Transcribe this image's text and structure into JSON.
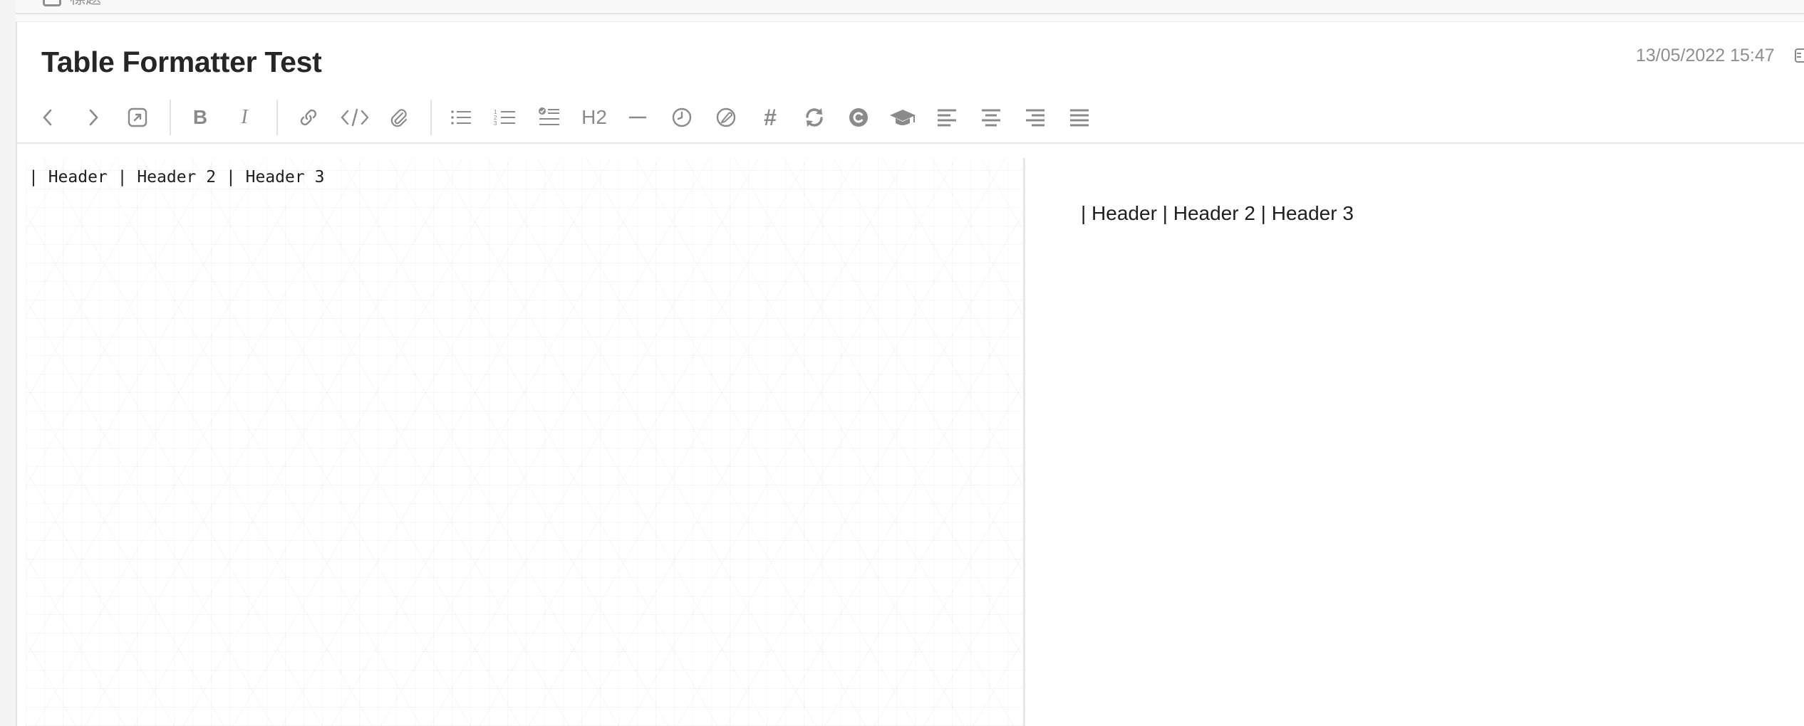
{
  "top_strip": {
    "label": "標題"
  },
  "note": {
    "title": "Table Formatter Test",
    "modified": "13/05/2022 15:47"
  },
  "toolbar": {
    "back": "chevron-left-icon",
    "forward": "chevron-right-icon",
    "external": "external-link-icon",
    "bold": "B",
    "italic": "I",
    "link": "link-icon",
    "code": "</>",
    "attach": "paperclip-icon",
    "bullet_list": "bulleted-list-icon",
    "numbered_list": "numbered-list-icon",
    "checklist": "checklist-icon",
    "heading": "H2",
    "horizontal_rule": "horizontal-rule-icon",
    "insert_time": "clock-icon",
    "spell": "spellcheck-icon",
    "tag": "#",
    "sync": "sync-icon",
    "copyright": "copyright-icon",
    "education": "graduation-cap-icon",
    "align_left": "align-left-icon",
    "align_center": "align-center-icon",
    "align_right": "align-right-icon",
    "justify": "align-justify-icon"
  },
  "editor": {
    "content": "| Header | Header 2 | Header 3"
  },
  "preview": {
    "content": "| Header | Header 2 | Header 3"
  },
  "colors": {
    "icon": "#8a8a8a",
    "title": "#262626",
    "date": "#8e8e8e",
    "divider": "#e7e7e7"
  }
}
